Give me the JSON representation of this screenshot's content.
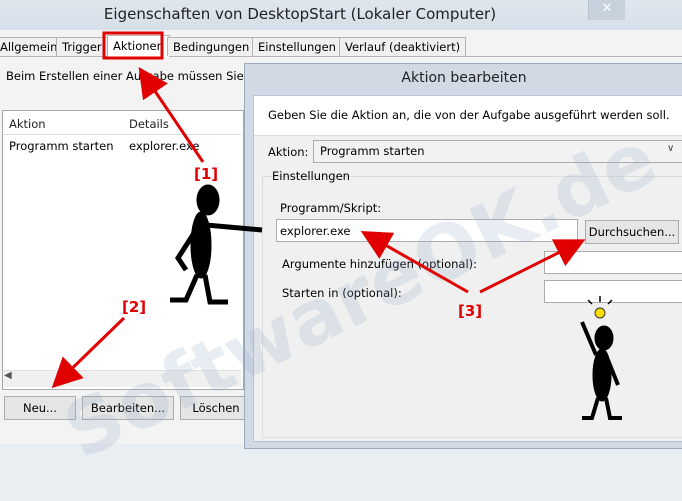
{
  "window": {
    "title": "Eigenschaften von DesktopStart (Lokaler Computer)",
    "close_glyph": "✕"
  },
  "tabs": [
    {
      "label": "Allgemein"
    },
    {
      "label": "Trigger"
    },
    {
      "label": "Aktionen",
      "active": true
    },
    {
      "label": "Bedingungen"
    },
    {
      "label": "Einstellungen"
    },
    {
      "label": "Verlauf (deaktiviert)"
    }
  ],
  "actions_tab": {
    "description": "Beim Erstellen einer Aufgabe müssen Sie di",
    "columns": [
      "Aktion",
      "Details"
    ],
    "rows": [
      {
        "aktion": "Programm starten",
        "details": "explorer.exe"
      }
    ],
    "buttons": {
      "new": "Neu...",
      "edit": "Bearbeiten...",
      "delete": "Löschen"
    }
  },
  "dialog": {
    "title": "Aktion bearbeiten",
    "description": "Geben Sie die Aktion an, die von der Aufgabe ausgeführt werden soll.",
    "action_label": "Aktion:",
    "action_value": "Programm starten",
    "settings_group": "Einstellungen",
    "program_label": "Programm/Skript:",
    "program_value": "explorer.exe",
    "browse_label": "Durchsuchen...",
    "args_label": "Argumente hinzufügen (optional):",
    "args_value": "",
    "start_label": "Starten in (optional):",
    "start_value": ""
  },
  "annotations": {
    "callouts": [
      "[1]",
      "[2]",
      "[3]"
    ],
    "arrow_color": "#e00000",
    "watermark": "SoftwareOK.de"
  }
}
